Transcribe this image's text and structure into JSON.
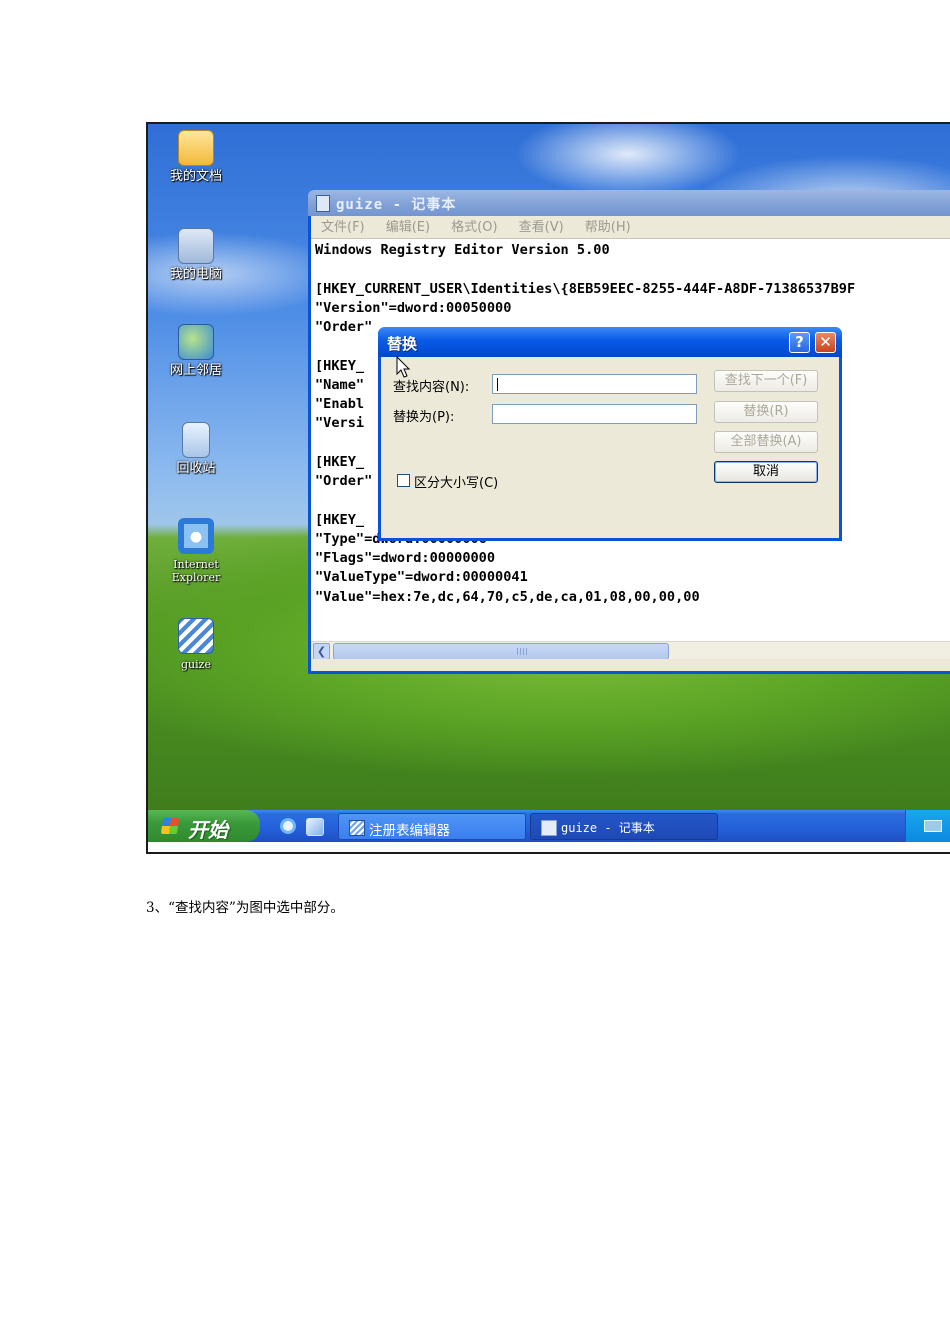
{
  "desktop": {
    "icons": [
      {
        "label": "我的文档",
        "icon": "my-documents-icon"
      },
      {
        "label": "我的电脑",
        "icon": "my-computer-icon"
      },
      {
        "label": "网上邻居",
        "icon": "network-places-icon"
      },
      {
        "label": "回收站",
        "icon": "recycle-bin-icon"
      },
      {
        "label_line1": "Internet",
        "label_line2": "Explorer",
        "icon": "ie-icon"
      },
      {
        "label": "guize",
        "icon": "registry-file-icon"
      }
    ]
  },
  "notepad": {
    "title": "guize - 记事本",
    "menu": [
      "文件(F)",
      "编辑(E)",
      "格式(O)",
      "查看(V)",
      "帮助(H)"
    ],
    "content": "Windows Registry Editor Version 5.00\n\n[HKEY_CURRENT_USER\\Identities\\{8EB59EEC-8255-444F-A8DF-71386537B9F\n\"Version\"=dword:00050000\n\"Order\"\n\n[HKEY_                                              71386537B9F\n\"Name\"\n\"Enabl\n\"Versi\n\n[HKEY_                                              71386537B9F\n\"Order\"\n\n[HKEY_                                              71386537B9F\n\"Type\"=dword:00000006\n\"Flags\"=dword:00000000\n\"ValueType\"=dword:00000041\n\"Value\"=hex:7e,dc,64,70,c5,de,ca,01,08,00,00,00"
  },
  "replace_dialog": {
    "title": "替换",
    "help_label": "?",
    "close_label": "✕",
    "find_label": "查找内容(N):",
    "find_value": "",
    "replace_label": "替换为(P):",
    "replace_value": "",
    "match_case_label": "区分大小写(C)",
    "match_case_checked": false,
    "buttons": {
      "find_next": "查找下一个(F)",
      "replace": "替换(R)",
      "replace_all": "全部替换(A)",
      "cancel": "取消"
    }
  },
  "taskbar": {
    "start_label": "开始",
    "tasks": [
      {
        "label": "注册表编辑器",
        "icon": "regedit-icon",
        "active": false
      },
      {
        "label": "guize - 记事本",
        "icon": "notepad-icon",
        "active": true
      }
    ],
    "tray_icon": "keyboard-icon"
  },
  "caption": "3、“查找内容”为图中选中部分。",
  "colors": {
    "titlebar_active": "#0a5ae6",
    "titlebar_inactive": "#7f9fd6",
    "dialog_face": "#ece9d8",
    "taskbar": "#245fd8",
    "start_button": "#3a9a3a"
  }
}
